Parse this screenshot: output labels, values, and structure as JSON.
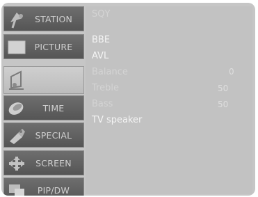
{
  "sidebar": {
    "items": [
      {
        "label": "STATION",
        "icon": "satellite-dish-icon"
      },
      {
        "label": "PICTURE",
        "icon": "picture-rectangle-icon"
      },
      {
        "label": "",
        "icon": "speaker-note-icon"
      },
      {
        "label": "TIME",
        "icon": "clock-disc-icon"
      },
      {
        "label": "SPECIAL",
        "icon": "wrench-tag-icon"
      },
      {
        "label": "SCREEN",
        "icon": "cross-arrows-icon"
      },
      {
        "label": "PIP/DW",
        "icon": "pip-windows-icon"
      }
    ]
  },
  "panel": {
    "options": [
      {
        "label": "SQY",
        "value": ""
      },
      {
        "label": "BBE",
        "value": ""
      },
      {
        "label": "AVL",
        "value": ""
      },
      {
        "label": "Balance",
        "value": "0"
      },
      {
        "label": "Treble",
        "value": "50"
      },
      {
        "label": "Bass",
        "value": "50"
      },
      {
        "label": "TV speaker",
        "value": ""
      }
    ]
  }
}
